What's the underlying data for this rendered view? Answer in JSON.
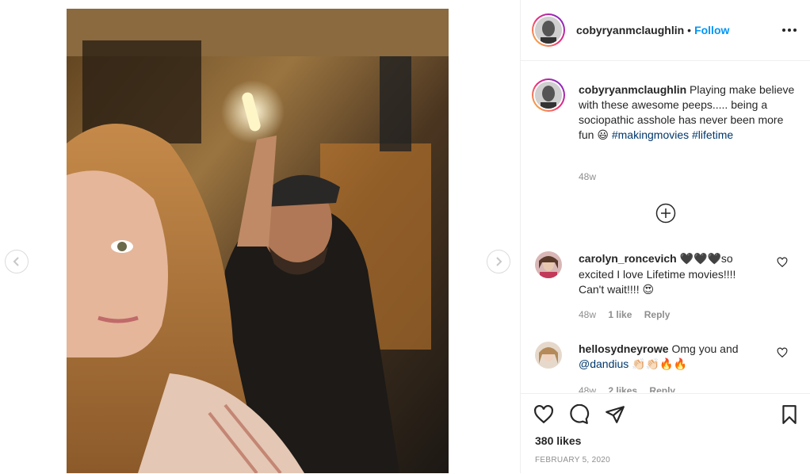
{
  "post": {
    "username": "cobyryanmclaughlin",
    "follow_label": "Follow",
    "dot": "•"
  },
  "caption": {
    "username": "cobyryanmclaughlin",
    "text": "Playing make believe with these awesome peeps..... being a sociopathic asshole has never been more fun",
    "emoji": "😃",
    "hashtag_1": "#makingmovies",
    "hashtag_2": "#lifetime",
    "time": "48w"
  },
  "comments": [
    {
      "username": "carolyn_roncevich",
      "text_start": "🖤🖤🖤",
      "text": "so excited I love Lifetime movies!!!! Can't wait!!!!",
      "emoji": "😍",
      "time": "48w",
      "likes": "1 like",
      "reply": "Reply"
    },
    {
      "username": "hellosydneyrowe",
      "text": "Omg you and",
      "mention": "@dandius",
      "emoji": "👏🏻👏🏻🔥🔥",
      "time": "48w",
      "likes": "2 likes",
      "reply": "Reply"
    }
  ],
  "footer": {
    "likes": "380 likes",
    "date": "FEBRUARY 5, 2020"
  },
  "icons": {
    "prev": "chevron-left-icon",
    "next": "chevron-right-icon",
    "more": "more-options-icon",
    "load_more": "plus-circle-icon",
    "like": "heart-icon",
    "comment": "comment-icon",
    "share": "paper-plane-icon",
    "save": "bookmark-icon"
  },
  "colors": {
    "accent": "#0095f6",
    "hashtag": "#00376b",
    "muted": "#8e8e8e",
    "text": "#262626"
  }
}
